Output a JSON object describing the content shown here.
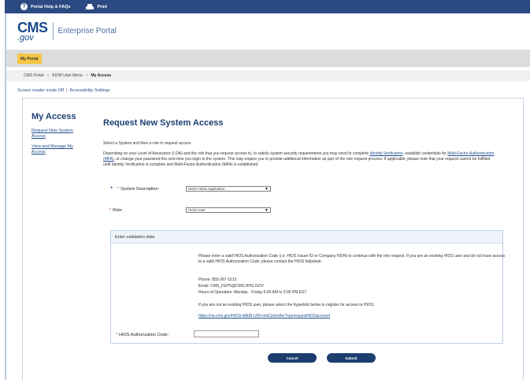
{
  "topbar": {
    "help_label": "Portal Help & FAQs",
    "help_icon": "question-circle-icon",
    "print_label": "Print",
    "print_icon": "printer-icon"
  },
  "header": {
    "logo_cms": "CMS",
    "logo_gov": ".gov",
    "portal_name": "Enterprise Portal"
  },
  "tabs": {
    "my_portal": "My Portal"
  },
  "breadcrumb": {
    "items": [
      "CMS Portal",
      "EIDM User Menu",
      "My Access"
    ],
    "separator": "»"
  },
  "accessibility": {
    "screen_reader": "Screen reader mode Off",
    "divider": "|",
    "settings": "Accessibility Settings"
  },
  "sidebar": {
    "title": "My Access",
    "links": [
      "Request New System Access",
      "View and Manage My Access"
    ]
  },
  "main": {
    "title": "Request New System Access",
    "instruction": "Select a System and then a role to request access",
    "para_1": "Depending on your Level of Assurance (LOA) and the role that you request access to, to satisfy system security requirements you may need to complete",
    "link_identity": "Identity Verification",
    "para_2": ", establish credentials for",
    "link_mfa": "Multi-Factor Authentication (MFA)",
    "para_3": ", or change your password the next time you login to the system. This may require you to provide additional information as part of the role request process. If applicable, please note that your request cannot be fulfilled until Identity Verification is complete and Multi-Factor Authentication (MFA) is established."
  },
  "form": {
    "required_mark": "*",
    "system_label": "System Description:",
    "system_value": "HIOS-HIOS Application",
    "role_label": "Role:",
    "role_value": "HIOS User"
  },
  "validation": {
    "header": "Enter validation data",
    "para_1": "Please enter a valid HIOS Authorization Code (i.e. HIOS Issuer ID or Company FEIN) to continue with the role request. If you are an existing HIOS user and do not have access to a valid HIOS Authorization Code, please contact the HIOS helpdesk:",
    "phone": "Phone: 855-267-1515",
    "email": "Email: CMS_FEPS@CMS.HHS.GOV",
    "hours": "Hours of Operation: Monday - Friday 9:00 AM to 5:00 PM EST",
    "para_2": "If you are not an existing HIOS user, please select the hyperlink below to register for access to HIOS:",
    "register_link": "https://ria.cms.gov/HIOS-MAIN-UI/FrontController?cpnrequestHIOSaccount",
    "auth_label": "HIOS Authorization Code:"
  },
  "buttons": {
    "cancel": "Cancel",
    "submit": "Submit"
  },
  "colors": {
    "brand_blue": "#2c4a82",
    "title_blue": "#1c3f73",
    "link_blue": "#1f4f8f",
    "tab_yellow": "#f6c543",
    "button_navy": "#1d3e6e"
  }
}
